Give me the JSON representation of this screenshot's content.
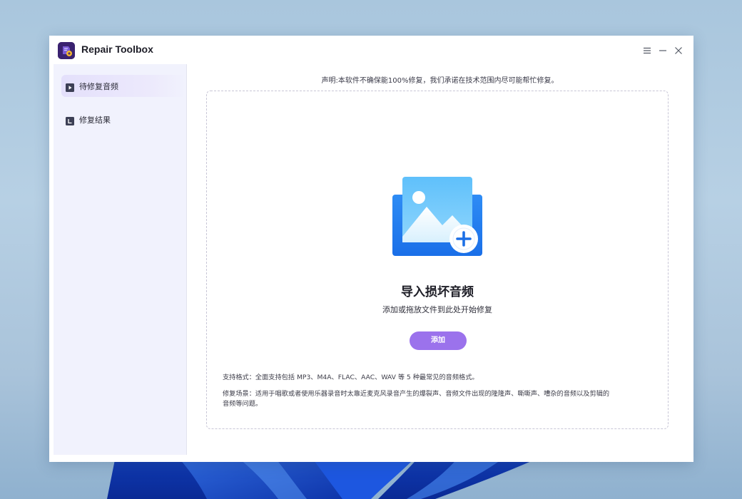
{
  "app": {
    "title": "Repair Toolbox",
    "logo_icon": "repair-toolbox-logo",
    "brand_color": "#2b1a55",
    "accent_color": "#9b72ec"
  },
  "window_controls": {
    "menu_icon": "menu-icon",
    "minimize_icon": "minimize-icon",
    "close_icon": "close-icon"
  },
  "sidebar": {
    "items": [
      {
        "label": "待修复音频",
        "icon": "play-file-icon",
        "active": true
      },
      {
        "label": "修复结果",
        "icon": "result-file-icon",
        "active": false
      }
    ]
  },
  "main": {
    "disclaimer": "声明:本软件不确保能100%修复，我们承诺在技术范围内尽可能帮忙修复。",
    "dropzone": {
      "illustration": "image-add-icon",
      "title": "导入损坏音频",
      "subtitle": "添加或拖放文件到此处开始修复",
      "add_button": "添加",
      "formats": "支持格式：全面支持包括 MP3、M4A、FLAC、AAC、WAV 等 5 种最常见的音频格式。",
      "scenario_line1": "修复场景：适用于唱歌或者使用乐器录音时太靠近麦克风录音产生的爆裂声、音频文件出现的隆隆声、嘶嘶声、嘈杂的音频以及剪辑的",
      "scenario_line2": "音频等问题。"
    }
  }
}
